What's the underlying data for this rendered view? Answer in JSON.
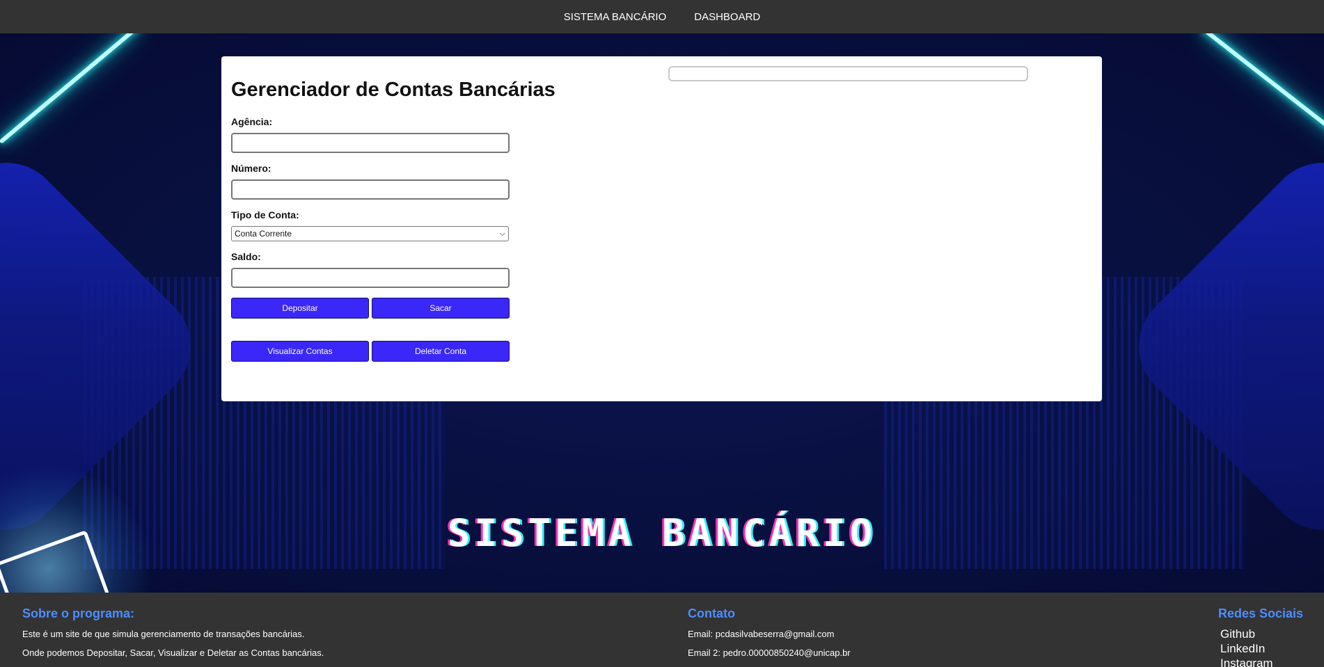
{
  "nav": {
    "items": [
      "SISTEMA BANCÁRIO",
      "DASHBOARD"
    ]
  },
  "form": {
    "title": "Gerenciador de Contas Bancárias",
    "agencia_label": "Agência:",
    "agencia_value": "",
    "numero_label": "Número:",
    "numero_value": "",
    "tipo_label": "Tipo de Conta:",
    "tipo_selected": "Conta Corrente",
    "saldo_label": "Saldo:",
    "saldo_value": "",
    "buttons": {
      "depositar": "Depositar",
      "sacar": "Sacar",
      "visualizar": "Visualizar Contas",
      "deletar": "Deletar Conta"
    }
  },
  "hero": {
    "title": "SISTEMA BANCÁRIO"
  },
  "footer": {
    "about": {
      "heading": "Sobre o programa:",
      "line1": "Este é um site de que simula gerenciamento de transações bancárias.",
      "line2": "Onde podemos Depositar, Sacar, Visualizar e Deletar as Contas bancárias."
    },
    "contact": {
      "heading": "Contato",
      "email1": "Email: pcdasilvabeserra@gmail.com",
      "email2": "Email 2: pedro.00000850240@unicap.br"
    },
    "social": {
      "heading": "Redes Sociais",
      "links": [
        "Github",
        "LinkedIn",
        "Instagram"
      ]
    }
  },
  "colors": {
    "accent_button": "#3b27f8",
    "footer_heading": "#4d8dff",
    "bar_bg": "#333333"
  }
}
